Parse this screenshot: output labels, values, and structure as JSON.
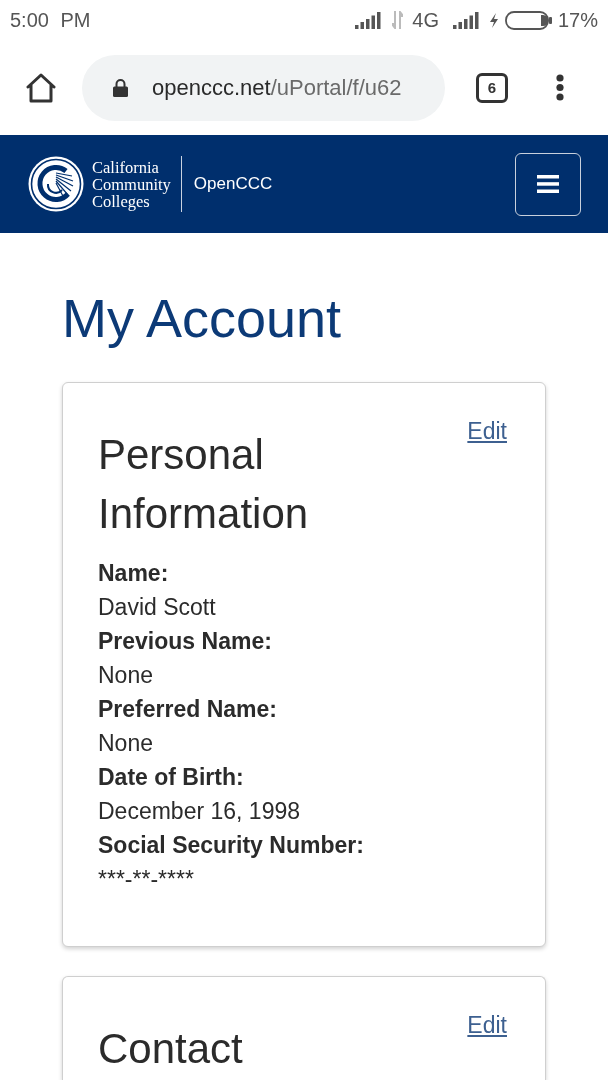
{
  "status_bar": {
    "time": "5:00 PM",
    "network": "4G",
    "battery": "17%"
  },
  "browser": {
    "url_host": "openccc.net",
    "url_path": "/uPortal/f/u62",
    "tab_count": "6"
  },
  "header": {
    "logo_text": "California Community Colleges",
    "app_name": "OpenCCC"
  },
  "page_title": "My Account",
  "cards": [
    {
      "title": "Personal Information",
      "edit": "Edit",
      "fields": [
        {
          "label": "Name:",
          "value": "David Scott"
        },
        {
          "label": "Previous Name:",
          "value": "None"
        },
        {
          "label": "Preferred Name:",
          "value": "None"
        },
        {
          "label": "Date of Birth:",
          "value": "December 16, 1998"
        },
        {
          "label": "Social Security Number:",
          "value": "***-**-****"
        }
      ]
    },
    {
      "title": "Contact",
      "edit": "Edit"
    }
  ]
}
